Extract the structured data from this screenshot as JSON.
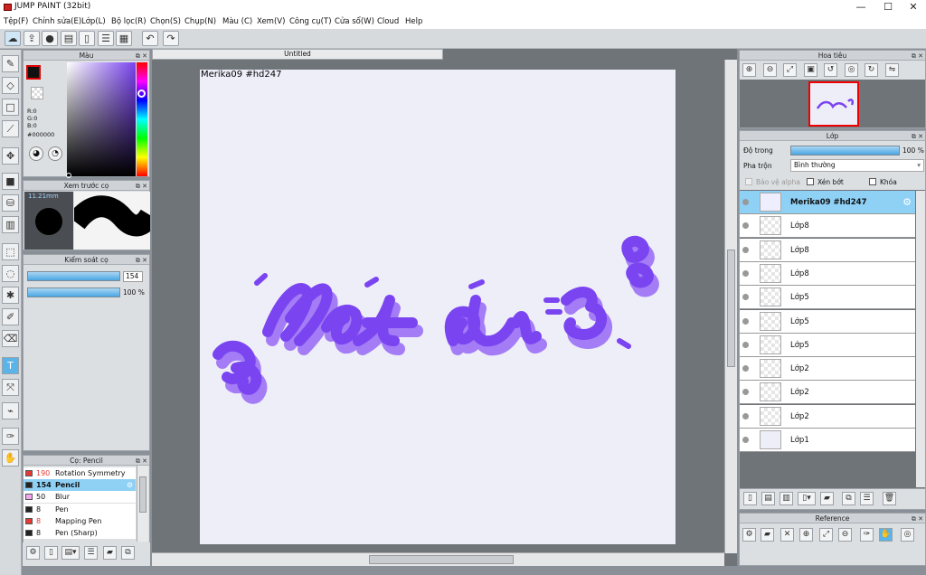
{
  "window": {
    "title": "JUMP PAINT (32bit)"
  },
  "menu": [
    "Tệp(F)",
    "Chỉnh sửa(E)",
    "Lớp(L)",
    "Bộ lọc(R)",
    "Chọn(S)",
    "Chụp(N)",
    "Màu (C)",
    "Xem(V)",
    "Công cụ(T)",
    "Cửa sổ(W)",
    "Cloud",
    "Help"
  ],
  "panels": {
    "color": {
      "title": "Màu",
      "r": "R:0",
      "g": "G:0",
      "b": "B:0",
      "hex": "#000000"
    },
    "brush_preview": {
      "title": "Xem trước cọ",
      "size": "11.21mm"
    },
    "brush_control": {
      "title": "Kiểm soát cọ",
      "size_value": "154",
      "opacity_value": "100 %",
      "size_fraction": 1.0,
      "opacity_fraction": 1.0
    },
    "brush_list": {
      "title": "Cọ: Pencil",
      "items": [
        {
          "size": "190",
          "name": "Rotation Symmetry Pen",
          "color": "#e53935",
          "selected": false
        },
        {
          "size": "154",
          "name": "Pencil",
          "color": "#222222",
          "selected": true
        },
        {
          "size": "50",
          "name": "Blur",
          "color": "#f4a6f0",
          "selected": false
        },
        {
          "size": "8",
          "name": "Pen",
          "color": "#222222",
          "selected": false
        },
        {
          "size": "8",
          "name": "Mapping Pen",
          "color": "#e53935",
          "selected": false
        },
        {
          "size": "8",
          "name": "Pen (Sharp)",
          "color": "#222222",
          "selected": false
        }
      ]
    },
    "navigator": {
      "title": "Hoa tiêu"
    },
    "layer": {
      "title": "Lớp",
      "opacity_label": "Độ trong",
      "opacity_value": "100 %",
      "blend_label": "Pha trộn",
      "blend_value": "Bình thường",
      "protect_alpha": "Bảo vệ alpha",
      "clipping": "Xén bớt",
      "lock": "Khóa",
      "layers": [
        "Merika09  #hd247",
        "Lớp8",
        "Lớp8",
        "Lớp8",
        "Lớp5",
        "Lớp5",
        "Lớp5",
        "Lớp2",
        "Lớp2",
        "Lớp2",
        "Lớp1"
      ]
    },
    "reference": {
      "title": "Reference"
    }
  },
  "document": {
    "tab": "Untitled",
    "caption": "Merika09  #hd247",
    "artwork": "Hát đi 3"
  },
  "colors": {
    "accent": "#5bb4e8",
    "art_main": "#7a44f0",
    "art_shadow": "#9f7ff5",
    "canvas_bg": "#eeeef9"
  }
}
